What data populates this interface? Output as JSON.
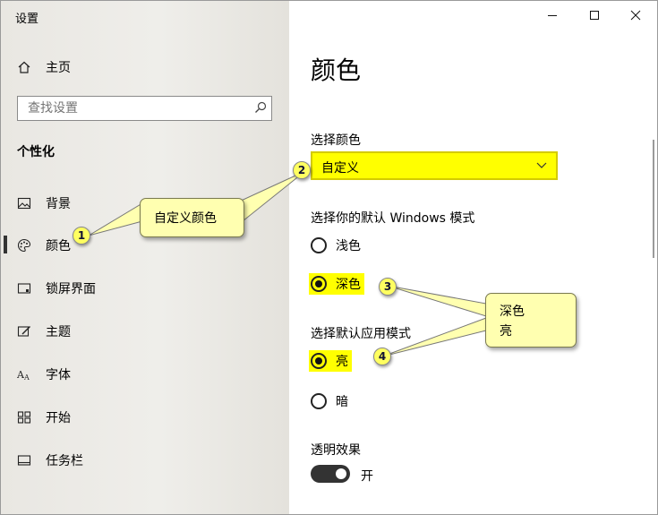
{
  "window": {
    "title": "设置"
  },
  "sidebar": {
    "home": "主页",
    "search_placeholder": "查找设置",
    "section": "个性化",
    "items": [
      {
        "label": "背景",
        "icon": "picture-icon"
      },
      {
        "label": "颜色",
        "icon": "palette-icon",
        "selected": true
      },
      {
        "label": "锁屏界面",
        "icon": "lock-screen-icon"
      },
      {
        "label": "主题",
        "icon": "theme-icon"
      },
      {
        "label": "字体",
        "icon": "font-icon"
      },
      {
        "label": "开始",
        "icon": "start-icon"
      },
      {
        "label": "任务栏",
        "icon": "taskbar-icon"
      }
    ]
  },
  "main": {
    "title": "颜色",
    "choose_color_label": "选择颜色",
    "choose_color_value": "自定义",
    "windows_mode_label": "选择你的默认 Windows 模式",
    "windows_mode_options": [
      {
        "label": "浅色",
        "selected": false
      },
      {
        "label": "深色",
        "selected": true
      }
    ],
    "app_mode_label": "选择默认应用模式",
    "app_mode_options": [
      {
        "label": "亮",
        "selected": true
      },
      {
        "label": "暗",
        "selected": false
      }
    ],
    "transparency_label": "透明效果",
    "transparency_state": "开"
  },
  "annotations": {
    "callout1": "自定义颜色",
    "callout2_line1": "深色",
    "callout2_line2": "亮",
    "badges": [
      "1",
      "2",
      "3",
      "4"
    ]
  },
  "colors": {
    "highlight": "#ffff00",
    "callout": "#ffffb0",
    "accent_dark": "#333333"
  }
}
